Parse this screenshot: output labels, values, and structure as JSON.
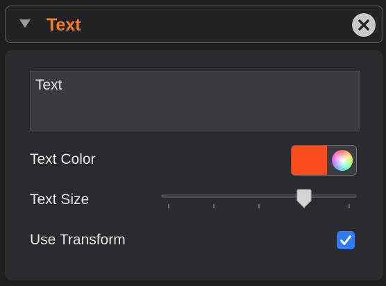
{
  "section": {
    "title": "Text",
    "collapsed": false,
    "disclosure_icon": "triangle-down-icon",
    "close_icon": "close-icon"
  },
  "text_content": {
    "value": "Text"
  },
  "text_color": {
    "label": "Text Color",
    "swatch_color": "#fc4d1f",
    "picker_icon": "color-wheel-icon"
  },
  "text_size": {
    "label": "Text Size",
    "value_fraction": 0.73,
    "tick_count": 5
  },
  "use_transform": {
    "label": "Use Transform",
    "checked": true
  },
  "colors": {
    "accent": "#f47d26",
    "checkbox": "#2f7cf6"
  }
}
